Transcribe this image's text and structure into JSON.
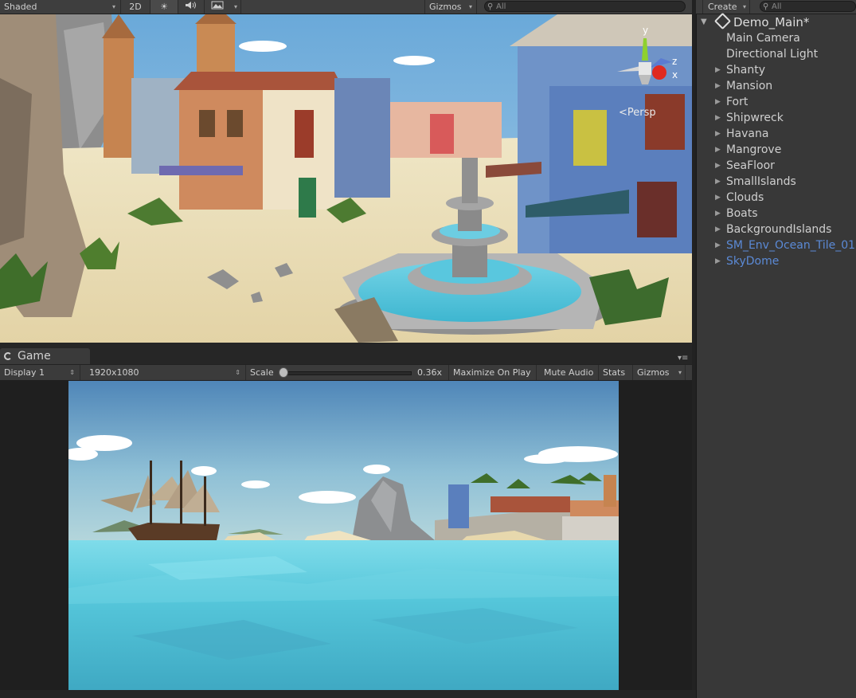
{
  "scene_toolbar": {
    "shading_mode": "Shaded",
    "mode_2d": "2D",
    "lighting_icon": "sun-icon",
    "audio_icon": "speaker-icon",
    "effects_icon": "image-icon",
    "gizmos": "Gizmos",
    "search_placeholder": "All"
  },
  "scene_view": {
    "projection": "Persp",
    "gizmo_axes": [
      "y",
      "z",
      "x"
    ]
  },
  "game_tab": {
    "label": "Game"
  },
  "game_toolbar": {
    "display": "Display 1",
    "resolution": "1920x1080",
    "scale_label": "Scale",
    "scale_value": "0.36x",
    "scale_fraction": 0.0,
    "maximize": "Maximize On Play",
    "mute": "Mute Audio",
    "stats": "Stats",
    "gizmos": "Gizmos"
  },
  "hierarchy": {
    "create": "Create",
    "search_placeholder": "All",
    "scene_name": "Demo_Main*",
    "items": [
      {
        "label": "Main Camera",
        "expandable": false,
        "prefab": false
      },
      {
        "label": "Directional Light",
        "expandable": false,
        "prefab": false
      },
      {
        "label": "Shanty",
        "expandable": true,
        "prefab": false
      },
      {
        "label": "Mansion",
        "expandable": true,
        "prefab": false
      },
      {
        "label": "Fort",
        "expandable": true,
        "prefab": false
      },
      {
        "label": "Shipwreck",
        "expandable": true,
        "prefab": false
      },
      {
        "label": "Havana",
        "expandable": true,
        "prefab": false
      },
      {
        "label": "Mangrove",
        "expandable": true,
        "prefab": false
      },
      {
        "label": "SeaFloor",
        "expandable": true,
        "prefab": false
      },
      {
        "label": "SmallIslands",
        "expandable": true,
        "prefab": false
      },
      {
        "label": "Clouds",
        "expandable": true,
        "prefab": false
      },
      {
        "label": "Boats",
        "expandable": true,
        "prefab": false
      },
      {
        "label": "BackgroundIslands",
        "expandable": true,
        "prefab": false
      },
      {
        "label": "SM_Env_Ocean_Tile_01",
        "expandable": true,
        "prefab": true
      },
      {
        "label": "SkyDome",
        "expandable": true,
        "prefab": true
      }
    ]
  },
  "colors": {
    "panel": "#383838",
    "toolbar": "#3e3e3e",
    "prefab_text": "#5b8ad6",
    "sky_top": "#4f86b8",
    "water": "#4fc6d8",
    "sand": "#e9dcb4"
  }
}
